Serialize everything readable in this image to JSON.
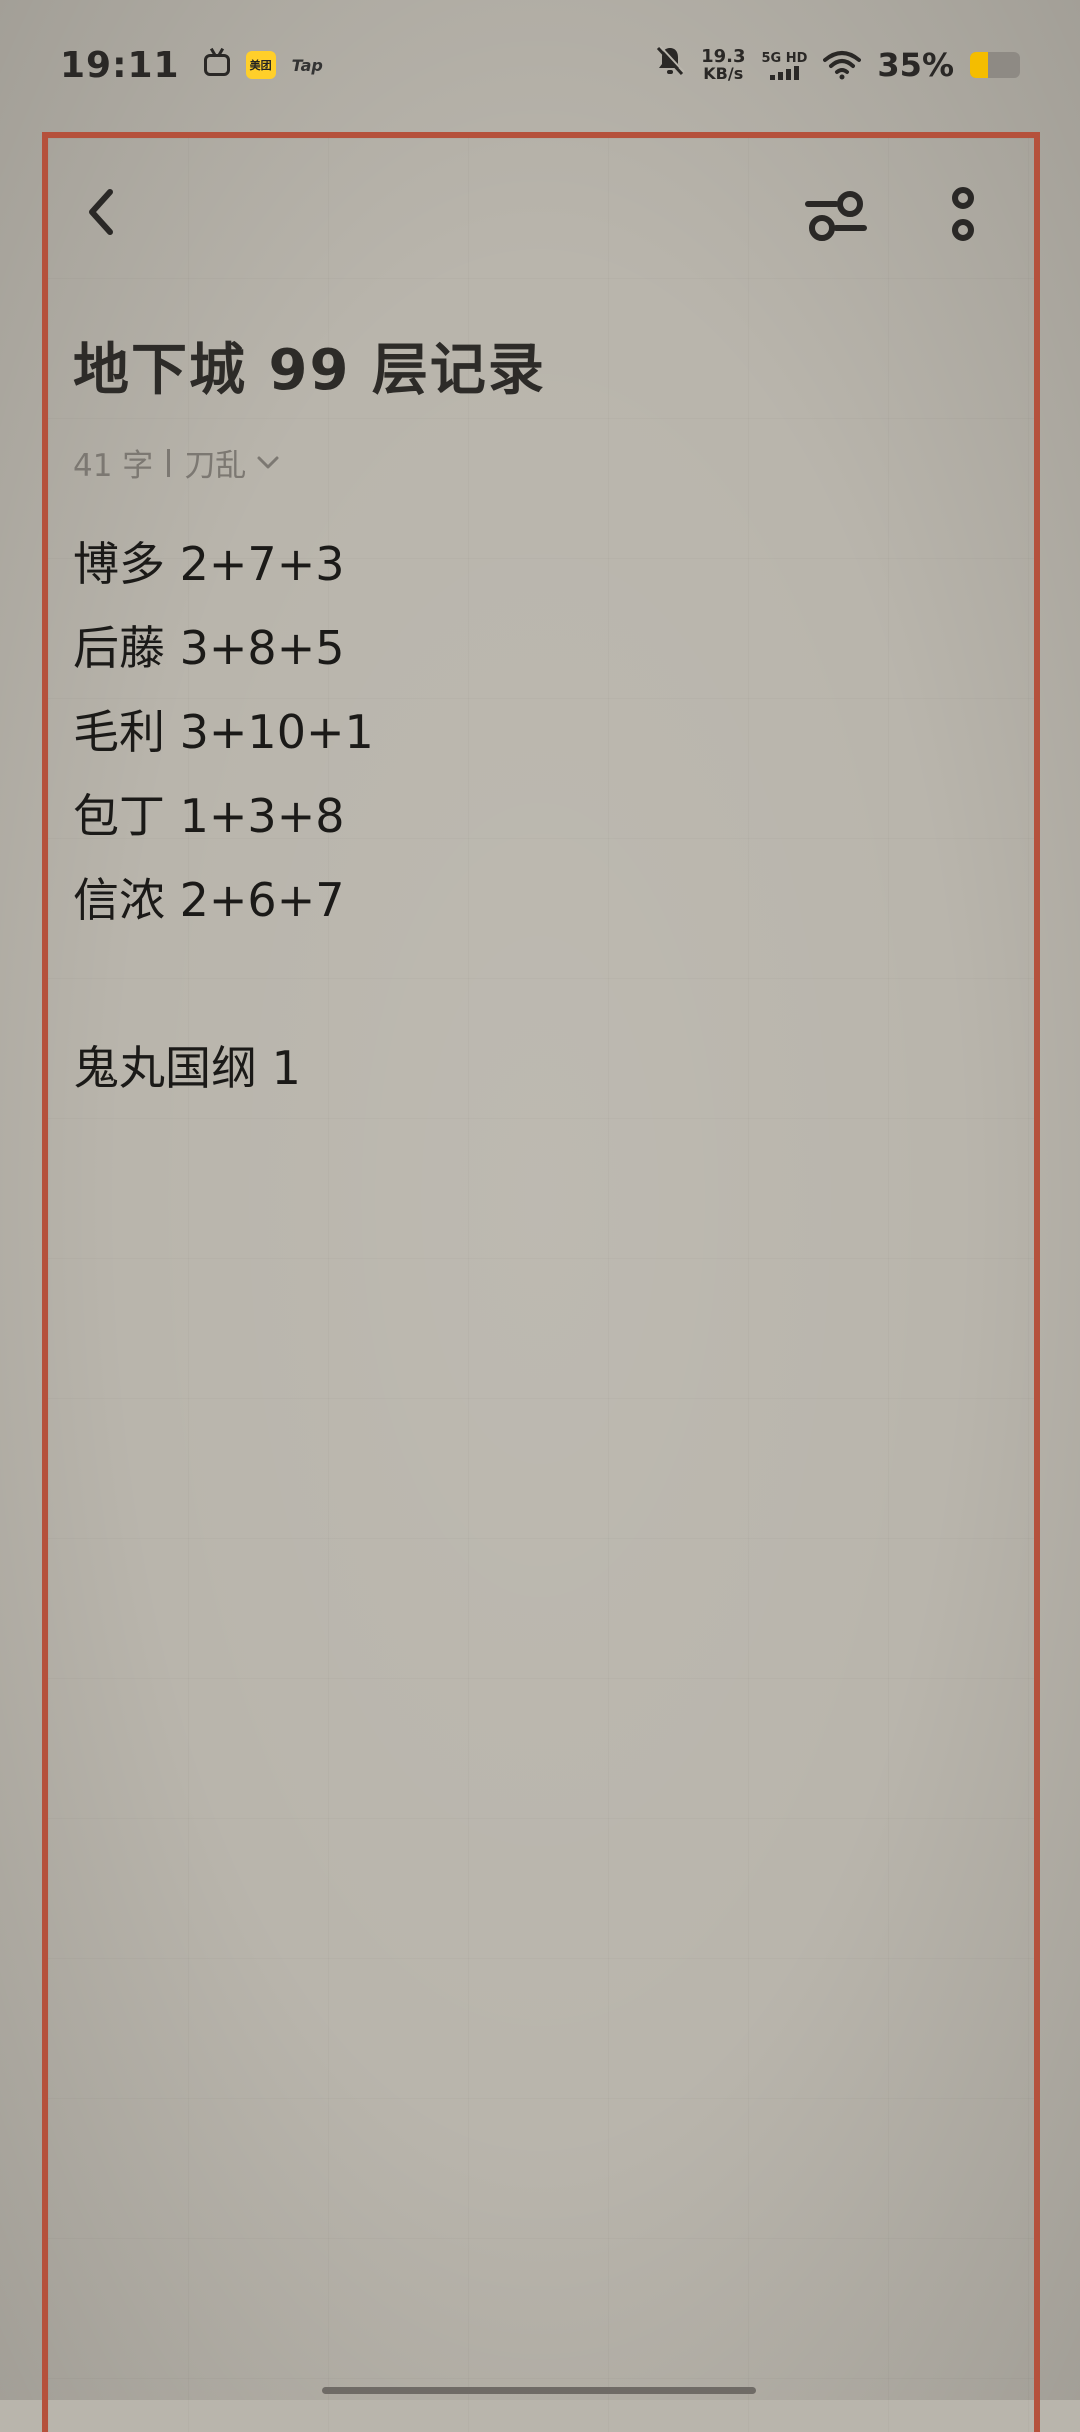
{
  "status_bar": {
    "time": "19:11",
    "meituan_label": "美团",
    "tap_label": "Tap",
    "net_speed_value": "19.3",
    "net_speed_unit": "KB/s",
    "network_label": "5G HD",
    "signal_strength": 4,
    "battery_percent_label": "35%",
    "battery_level": 0.35,
    "colors": {
      "battery_fill": "#f4bd00",
      "meituan": "#ffcf2a"
    }
  },
  "toolbar": {
    "back_icon": "chevron-left-icon",
    "filter_icon": "sliders-icon",
    "more_icon": "vertical-dots-icon"
  },
  "note": {
    "title": "地下城 99 层记录",
    "word_count": "41 字",
    "folder": "刀乱",
    "folder_icon": "chevron-down-icon",
    "lines": [
      "博多 2+7+3",
      "后藤 3+8+5",
      "毛利 3+10+1",
      "包丁 1+3+8",
      "信浓 2+6+7",
      "",
      "鬼丸国纲 1"
    ]
  },
  "theme": {
    "paper": "#b9b5ac",
    "frame_border": "#b5513c"
  }
}
